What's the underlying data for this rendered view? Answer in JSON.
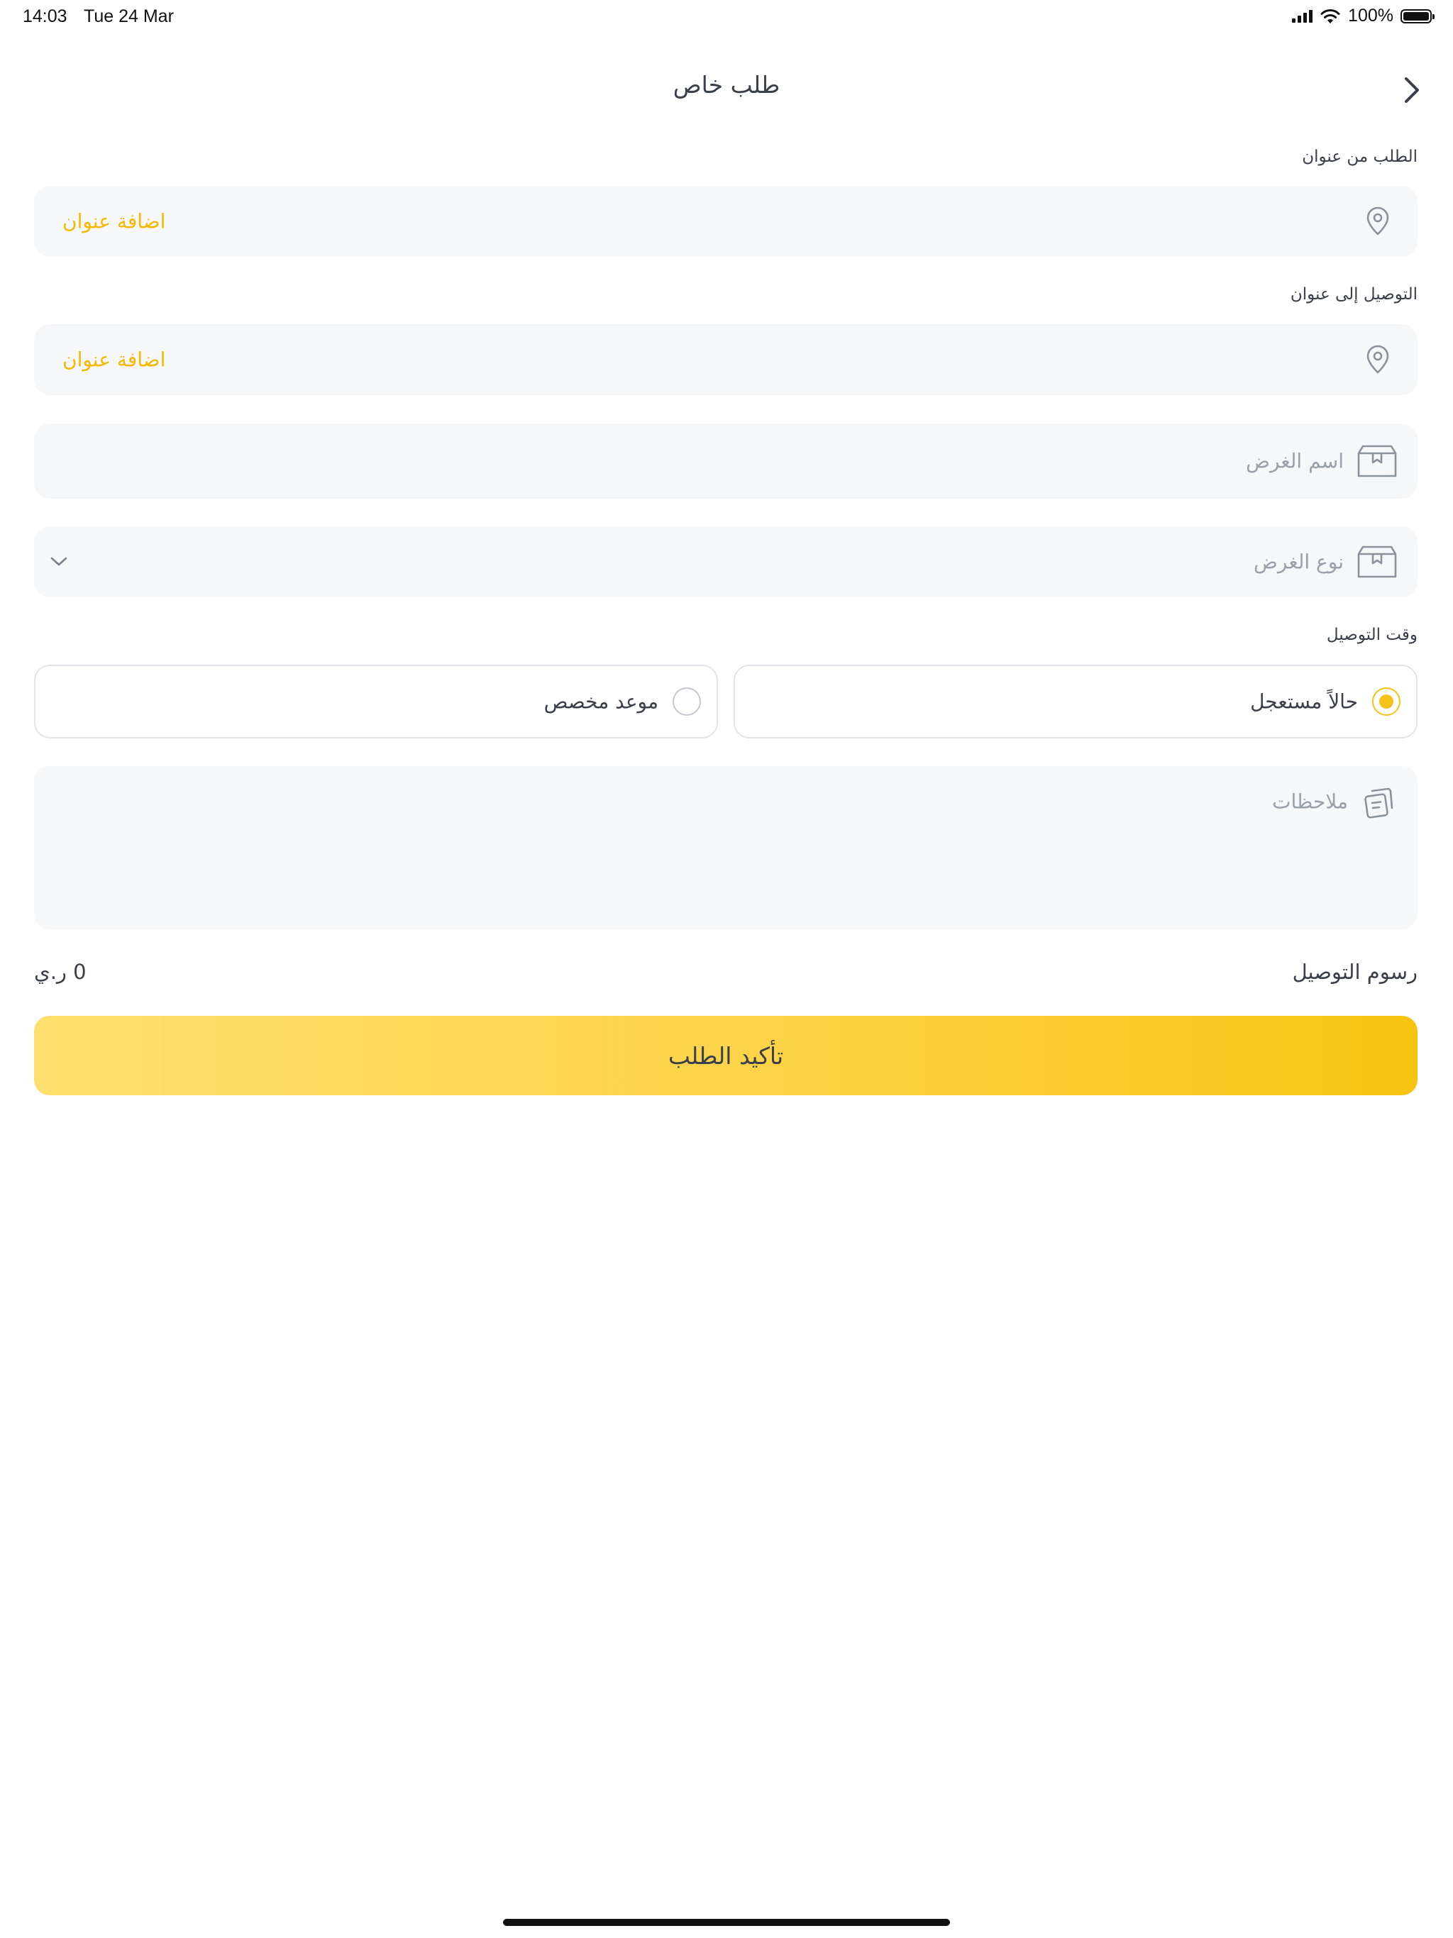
{
  "status_bar": {
    "time": "14:03",
    "date": "Tue 24 Mar",
    "battery_label": "100%"
  },
  "header": {
    "title": "طلب خاص"
  },
  "pickup": {
    "label": "الطلب من عنوان",
    "action": "اضافة عنوان"
  },
  "delivery": {
    "label": "التوصيل إلى عنوان",
    "action": "اضافة عنوان"
  },
  "item_name": {
    "placeholder": "اسم الغرض"
  },
  "item_type": {
    "placeholder": "نوع الغرض"
  },
  "delivery_time": {
    "label": "وقت التوصيل",
    "options": [
      {
        "label": "حالاً مستعجل",
        "selected": true
      },
      {
        "label": "موعد مخصص",
        "selected": false
      }
    ]
  },
  "notes": {
    "placeholder": "ملاحظات"
  },
  "fees": {
    "label": "رسوم التوصيل",
    "value": "0 ر.ي"
  },
  "confirm": {
    "label": "تأكيد الطلب"
  },
  "colors": {
    "accent": "#f5c21a",
    "field_bg": "#f6f7f9",
    "text": "#3a3f4a",
    "placeholder": "#9aa0aa"
  },
  "icons": {
    "location": "location-pin-icon",
    "box": "package-icon",
    "notes": "notes-icon",
    "back": "chevron-right-icon",
    "dropdown": "chevron-down-icon"
  }
}
